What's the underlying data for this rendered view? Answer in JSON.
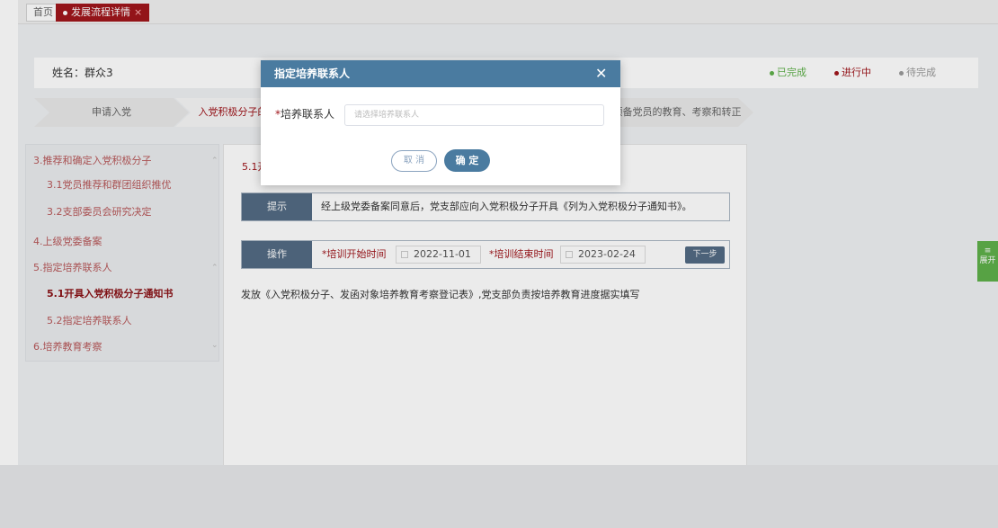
{
  "tabs": {
    "home": "首页",
    "active": "发展流程详情",
    "close": "×"
  },
  "info": {
    "name": "姓名：群众3",
    "legend": [
      {
        "label": "已完成",
        "color": "#5fb04a"
      },
      {
        "label": "进行中",
        "color": "#a0161c"
      },
      {
        "label": "待完成",
        "color": "#999999"
      }
    ]
  },
  "steps": [
    "申请入党",
    "入党积极分子的确定",
    "预备党员的教育、考察和转正"
  ],
  "sidebar": {
    "items": [
      {
        "label": "3.推荐和确定入党积极分子",
        "chevron": "⌃"
      },
      {
        "label": "3.1党员推荐和群团组织推优"
      },
      {
        "label": "3.2支部委员会研究决定"
      },
      {
        "label": "4.上级党委备案"
      },
      {
        "label": "5.指定培养联系人",
        "chevron": "⌃"
      },
      {
        "label": "5.1开具入党积极分子通知书"
      },
      {
        "label": "5.2指定培养联系人"
      },
      {
        "label": "6.培养教育考察",
        "chevron": "⌄"
      }
    ]
  },
  "content": {
    "title": "5.1开",
    "hint_label": "提示",
    "hint_text": "经上级党委备案同意后，党支部应向入党积极分子开具《列为入党积极分子通知书》。",
    "op_label": "操作",
    "start_label": "培训开始时间",
    "start_value": "2022-11-01",
    "end_label": "培训结束时间",
    "end_value": "2023-02-24",
    "next_label": "下一步",
    "desc": "发放《入党积极分子、发函对象培养教育考察登记表》,党支部负责按培养教育进度据实填写"
  },
  "right_tab": "展开",
  "modal": {
    "title": "指定培养联系人",
    "close": "✕",
    "field_label": "培养联系人",
    "required": "*",
    "placeholder": "请选择培养联系人",
    "cancel": "取 消",
    "ok": "确 定"
  }
}
